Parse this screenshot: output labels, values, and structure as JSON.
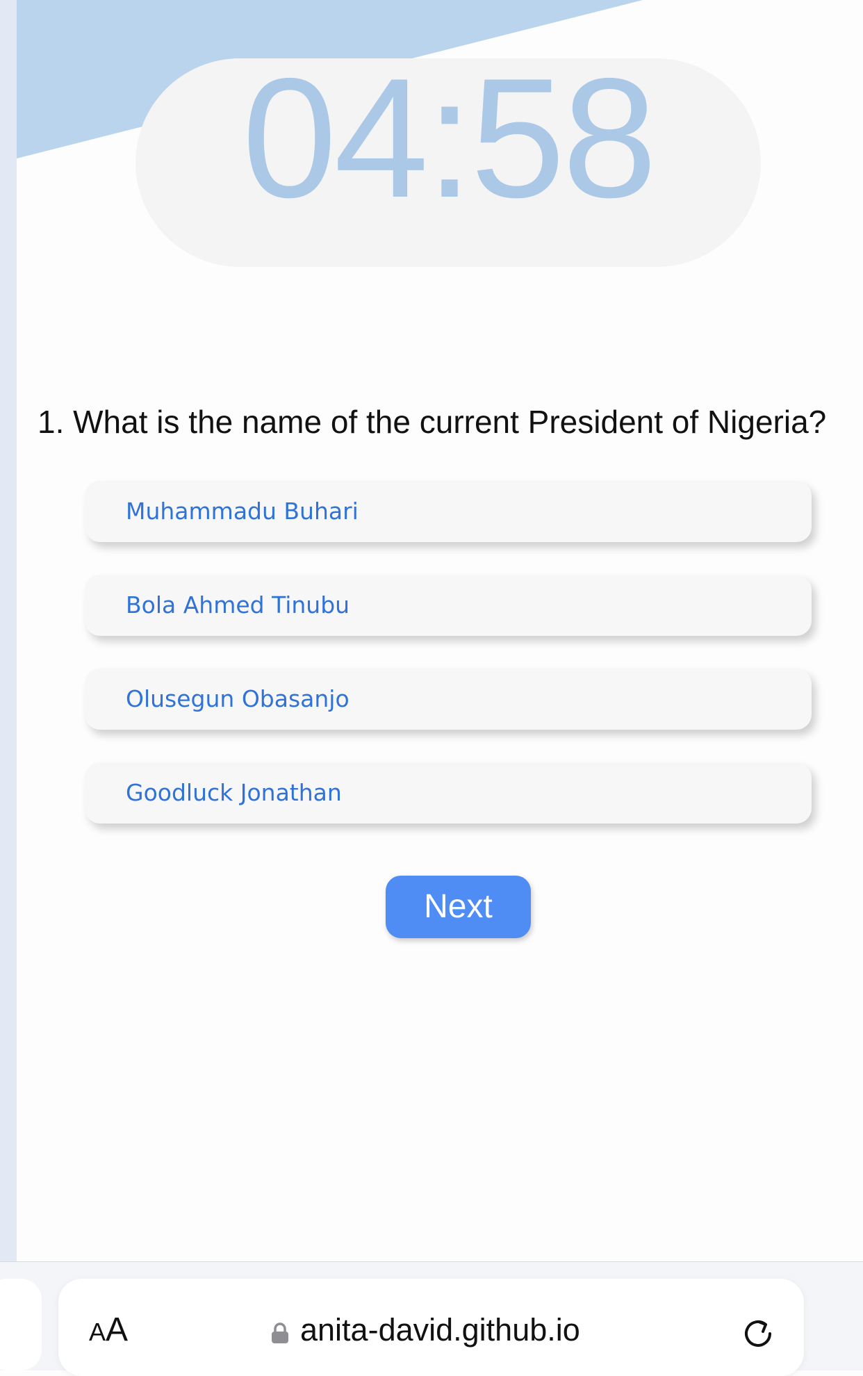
{
  "timer": {
    "value": "04:58"
  },
  "quiz": {
    "question": "1. What is the name of the current President of Nigeria?",
    "options": [
      {
        "label": "Muhammadu Buhari"
      },
      {
        "label": "Bola Ahmed Tinubu"
      },
      {
        "label": "Olusegun Obasanjo"
      },
      {
        "label": "Goodluck Jonathan"
      }
    ],
    "next_label": "Next"
  },
  "browser": {
    "text_size_label_small": "A",
    "text_size_label_large": "A",
    "url": "anita-david.github.io",
    "icons": [
      "lock-icon",
      "reload-icon"
    ]
  },
  "colors": {
    "accent": "#4f8df5",
    "timer": "#abc8e6",
    "option_text": "#2f72d8",
    "banner": "#b9d4ec"
  }
}
